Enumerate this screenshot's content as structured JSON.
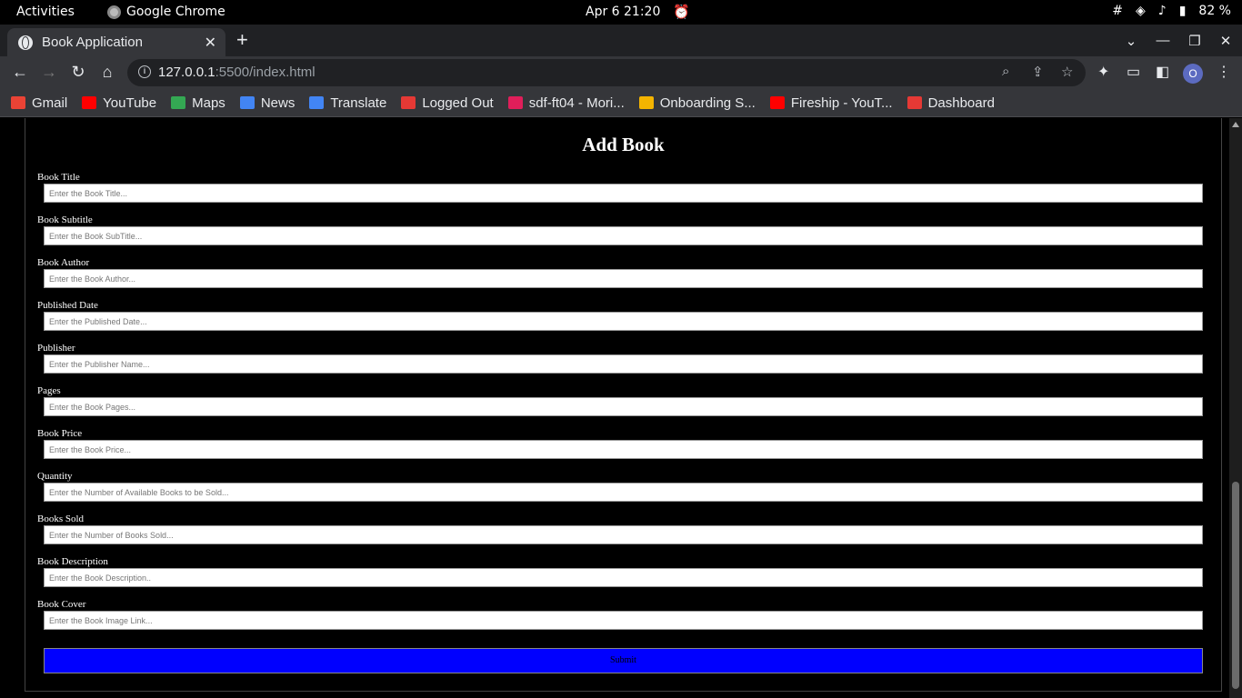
{
  "system": {
    "activities": "Activities",
    "app_name": "Google Chrome",
    "clock": "Apr 6  21:20",
    "battery": "82 %"
  },
  "browser": {
    "tab_title": "Book Application",
    "url_host": "127.0.0.1",
    "url_rest": ":5500/index.html",
    "profile_initial": "O",
    "bookmarks": [
      {
        "label": "Gmail",
        "color": "#ea4335"
      },
      {
        "label": "YouTube",
        "color": "#ff0000"
      },
      {
        "label": "Maps",
        "color": "#34a853"
      },
      {
        "label": "News",
        "color": "#4285f4"
      },
      {
        "label": "Translate",
        "color": "#4285f4"
      },
      {
        "label": "Logged Out",
        "color": "#e53935"
      },
      {
        "label": "sdf-ft04 - Mori...",
        "color": "#e01e5a"
      },
      {
        "label": "Onboarding S...",
        "color": "#f4b400"
      },
      {
        "label": "Fireship - YouT...",
        "color": "#ff0000"
      },
      {
        "label": "Dashboard",
        "color": "#e53935"
      }
    ]
  },
  "form": {
    "heading": "Add Book",
    "fields": [
      {
        "label": "Book Title",
        "placeholder": "Enter the Book Title..."
      },
      {
        "label": "Book Subtitle",
        "placeholder": "Enter the Book SubTitle..."
      },
      {
        "label": "Book Author",
        "placeholder": "Enter the Book Author..."
      },
      {
        "label": "Published Date",
        "placeholder": "Enter the Published Date..."
      },
      {
        "label": "Publisher",
        "placeholder": "Enter the Publisher Name..."
      },
      {
        "label": "Pages",
        "placeholder": "Enter the Book Pages..."
      },
      {
        "label": "Book Price",
        "placeholder": "Enter the Book Price..."
      },
      {
        "label": "Quantity",
        "placeholder": "Enter the Number of Available Books to be Sold..."
      },
      {
        "label": "Books Sold",
        "placeholder": "Enter the Number of Books Sold..."
      },
      {
        "label": "Book Description",
        "placeholder": "Enter the Book Description.."
      },
      {
        "label": "Book Cover",
        "placeholder": "Enter the Book Image Link..."
      }
    ],
    "submit_label": "Submit",
    "submit_color": "#0000ff"
  }
}
